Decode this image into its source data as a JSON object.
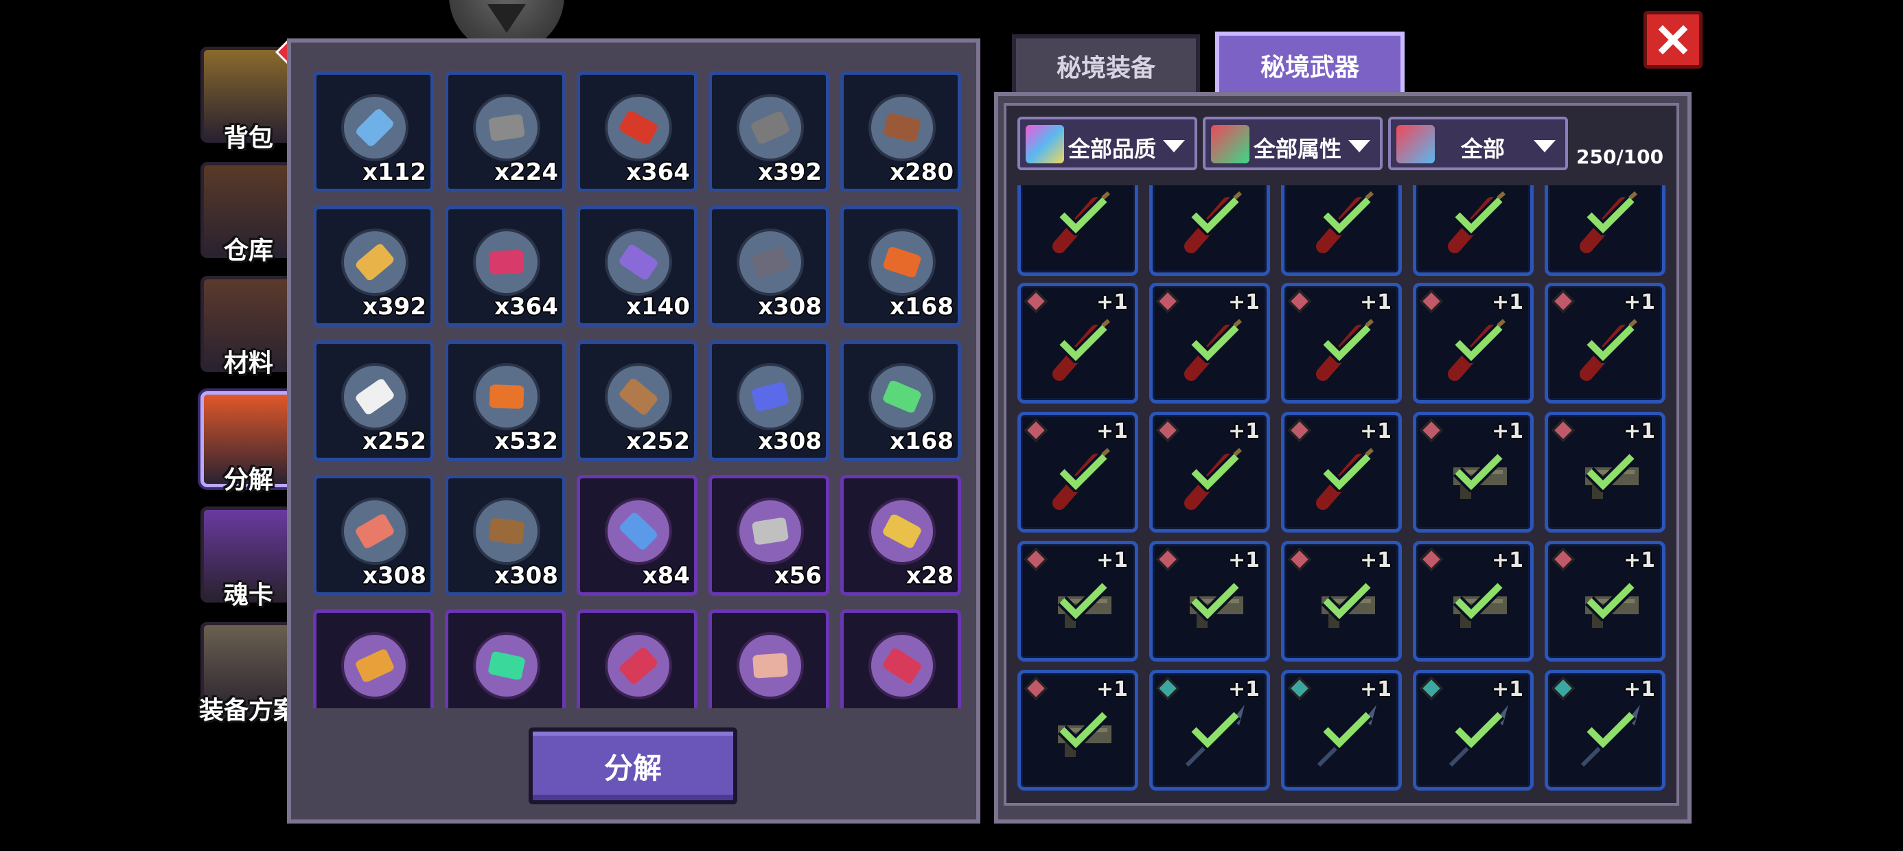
{
  "sidebar": {
    "items": [
      {
        "label": "背包",
        "icon": "backpack-icon",
        "color": "#8a6a2c"
      },
      {
        "label": "仓库",
        "icon": "warehouse-chest-icon",
        "color": "#5a3a28"
      },
      {
        "label": "材料",
        "icon": "materials-icon",
        "color": "#5c3a2c"
      },
      {
        "label": "分解",
        "icon": "furnace-icon",
        "color": "#e0582a",
        "active": true
      },
      {
        "label": "魂卡",
        "icon": "soul-card-icon",
        "color": "#6a3aa0"
      },
      {
        "label": "装备方案",
        "icon": "equipment-plan-icon",
        "color": "#6a6050"
      }
    ]
  },
  "materials": [
    {
      "count": "x112",
      "color": "#6fb0e8",
      "rarity": "blue"
    },
    {
      "count": "x224",
      "color": "#8a8a8a",
      "rarity": "blue"
    },
    {
      "count": "x364",
      "color": "#d83a2a",
      "rarity": "blue"
    },
    {
      "count": "x392",
      "color": "#7a7a7a",
      "rarity": "blue"
    },
    {
      "count": "x280",
      "color": "#9a5a3a",
      "rarity": "blue"
    },
    {
      "count": "x392",
      "color": "#e8b44a",
      "rarity": "blue"
    },
    {
      "count": "x364",
      "color": "#d83a6a",
      "rarity": "blue"
    },
    {
      "count": "x140",
      "color": "#8a6ad8",
      "rarity": "blue"
    },
    {
      "count": "x308",
      "color": "#6a6a7a",
      "rarity": "blue"
    },
    {
      "count": "x168",
      "color": "#e86a2a",
      "rarity": "blue"
    },
    {
      "count": "x252",
      "color": "#f0f0f0",
      "rarity": "blue"
    },
    {
      "count": "x532",
      "color": "#e8742a",
      "rarity": "blue"
    },
    {
      "count": "x252",
      "color": "#b07a4a",
      "rarity": "blue"
    },
    {
      "count": "x308",
      "color": "#5a6ae8",
      "rarity": "blue"
    },
    {
      "count": "x168",
      "color": "#5ad87a",
      "rarity": "blue"
    },
    {
      "count": "x308",
      "color": "#e87a6a",
      "rarity": "blue"
    },
    {
      "count": "x308",
      "color": "#9a6a3a",
      "rarity": "blue"
    },
    {
      "count": "x84",
      "color": "#5a9ae8",
      "rarity": "purple"
    },
    {
      "count": "x56",
      "color": "#c0c0c0",
      "rarity": "purple"
    },
    {
      "count": "x28",
      "color": "#e8c04a",
      "rarity": "purple"
    },
    {
      "count": "",
      "color": "#e8a03a",
      "rarity": "purple"
    },
    {
      "count": "",
      "color": "#3ad89a",
      "rarity": "purple"
    },
    {
      "count": "",
      "color": "#d83a5a",
      "rarity": "purple"
    },
    {
      "count": "",
      "color": "#e8b0a0",
      "rarity": "purple"
    },
    {
      "count": "",
      "color": "#d83a5a",
      "rarity": "purple"
    }
  ],
  "decompose_button": "分解",
  "tabs": {
    "equipment": "秘境装备",
    "weapons": "秘境武器"
  },
  "filters": [
    {
      "label": "全部品质",
      "icon": "quality-gem-icon",
      "colors": [
        "#f05ad8",
        "#5ab8f0",
        "#f0d85a"
      ]
    },
    {
      "label": "全部属性",
      "icon": "attribute-icon",
      "colors": [
        "#f0485a",
        "#3ad88a"
      ]
    },
    {
      "label": "全部",
      "icon": "weapon-type-icon",
      "colors": [
        "#f0485a",
        "#5ab8f0"
      ]
    }
  ],
  "capacity": "250/100",
  "weapons": [
    {
      "kind": "red",
      "plus": "",
      "gem": ""
    },
    {
      "kind": "red",
      "plus": "",
      "gem": ""
    },
    {
      "kind": "red",
      "plus": "",
      "gem": ""
    },
    {
      "kind": "red",
      "plus": "",
      "gem": ""
    },
    {
      "kind": "red",
      "plus": "",
      "gem": ""
    },
    {
      "kind": "red",
      "plus": "+1",
      "gem": "#c05a6a"
    },
    {
      "kind": "red",
      "plus": "+1",
      "gem": "#c05a6a"
    },
    {
      "kind": "red",
      "plus": "+1",
      "gem": "#c05a6a"
    },
    {
      "kind": "red",
      "plus": "+1",
      "gem": "#c05a6a"
    },
    {
      "kind": "red",
      "plus": "+1",
      "gem": "#c05a6a"
    },
    {
      "kind": "red",
      "plus": "+1",
      "gem": "#c05a6a"
    },
    {
      "kind": "red",
      "plus": "+1",
      "gem": "#c05a6a"
    },
    {
      "kind": "red",
      "plus": "+1",
      "gem": "#c05a6a"
    },
    {
      "kind": "gun",
      "plus": "+1",
      "gem": "#c05a6a"
    },
    {
      "kind": "gun",
      "plus": "+1",
      "gem": "#c05a6a"
    },
    {
      "kind": "gun",
      "plus": "+1",
      "gem": "#c05a6a"
    },
    {
      "kind": "gun",
      "plus": "+1",
      "gem": "#c05a6a"
    },
    {
      "kind": "gun",
      "plus": "+1",
      "gem": "#c05a6a"
    },
    {
      "kind": "gun",
      "plus": "+1",
      "gem": "#c05a6a"
    },
    {
      "kind": "gun",
      "plus": "+1",
      "gem": "#c05a6a"
    },
    {
      "kind": "gun",
      "plus": "+1",
      "gem": "#c05a6a"
    },
    {
      "kind": "spear",
      "plus": "+1",
      "gem": "#3aa8a0"
    },
    {
      "kind": "spear",
      "plus": "+1",
      "gem": "#3aa8a0"
    },
    {
      "kind": "spear",
      "plus": "+1",
      "gem": "#3aa8a0"
    },
    {
      "kind": "spear",
      "plus": "+1",
      "gem": "#3aa8a0"
    }
  ]
}
